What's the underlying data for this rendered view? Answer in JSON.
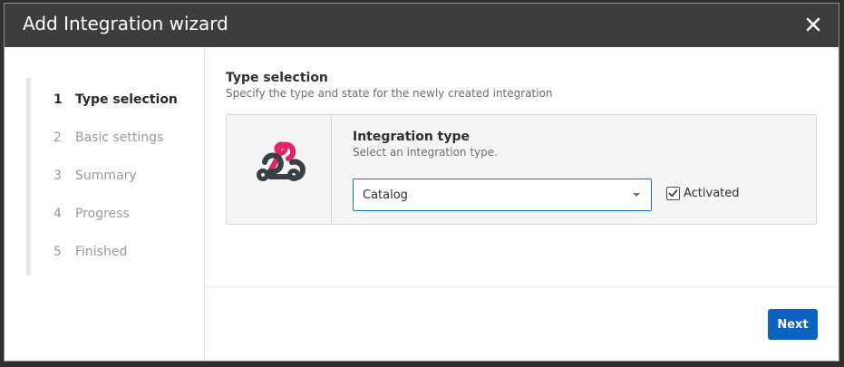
{
  "dialog": {
    "title": "Add Integration wizard",
    "close_icon": "close-icon"
  },
  "steps": [
    {
      "num": "1",
      "label": "Type selection",
      "active": true
    },
    {
      "num": "2",
      "label": "Basic settings",
      "active": false
    },
    {
      "num": "3",
      "label": "Summary",
      "active": false
    },
    {
      "num": "4",
      "label": "Progress",
      "active": false
    },
    {
      "num": "5",
      "label": "Finished",
      "active": false
    }
  ],
  "section": {
    "title": "Type selection",
    "subtitle": "Specify the type and state for the newly created integration"
  },
  "integration": {
    "logo_icon": "webhook-icon",
    "field_title": "Integration type",
    "field_hint": "Select an integration type.",
    "selected_type": "Catalog",
    "activated_label": "Activated",
    "activated": true
  },
  "footer": {
    "next_label": "Next"
  },
  "colors": {
    "titlebar": "#3d3d3d",
    "accent": "#0b63c4",
    "webhook_pink": "#e3256b",
    "webhook_dark": "#3a3f45"
  }
}
